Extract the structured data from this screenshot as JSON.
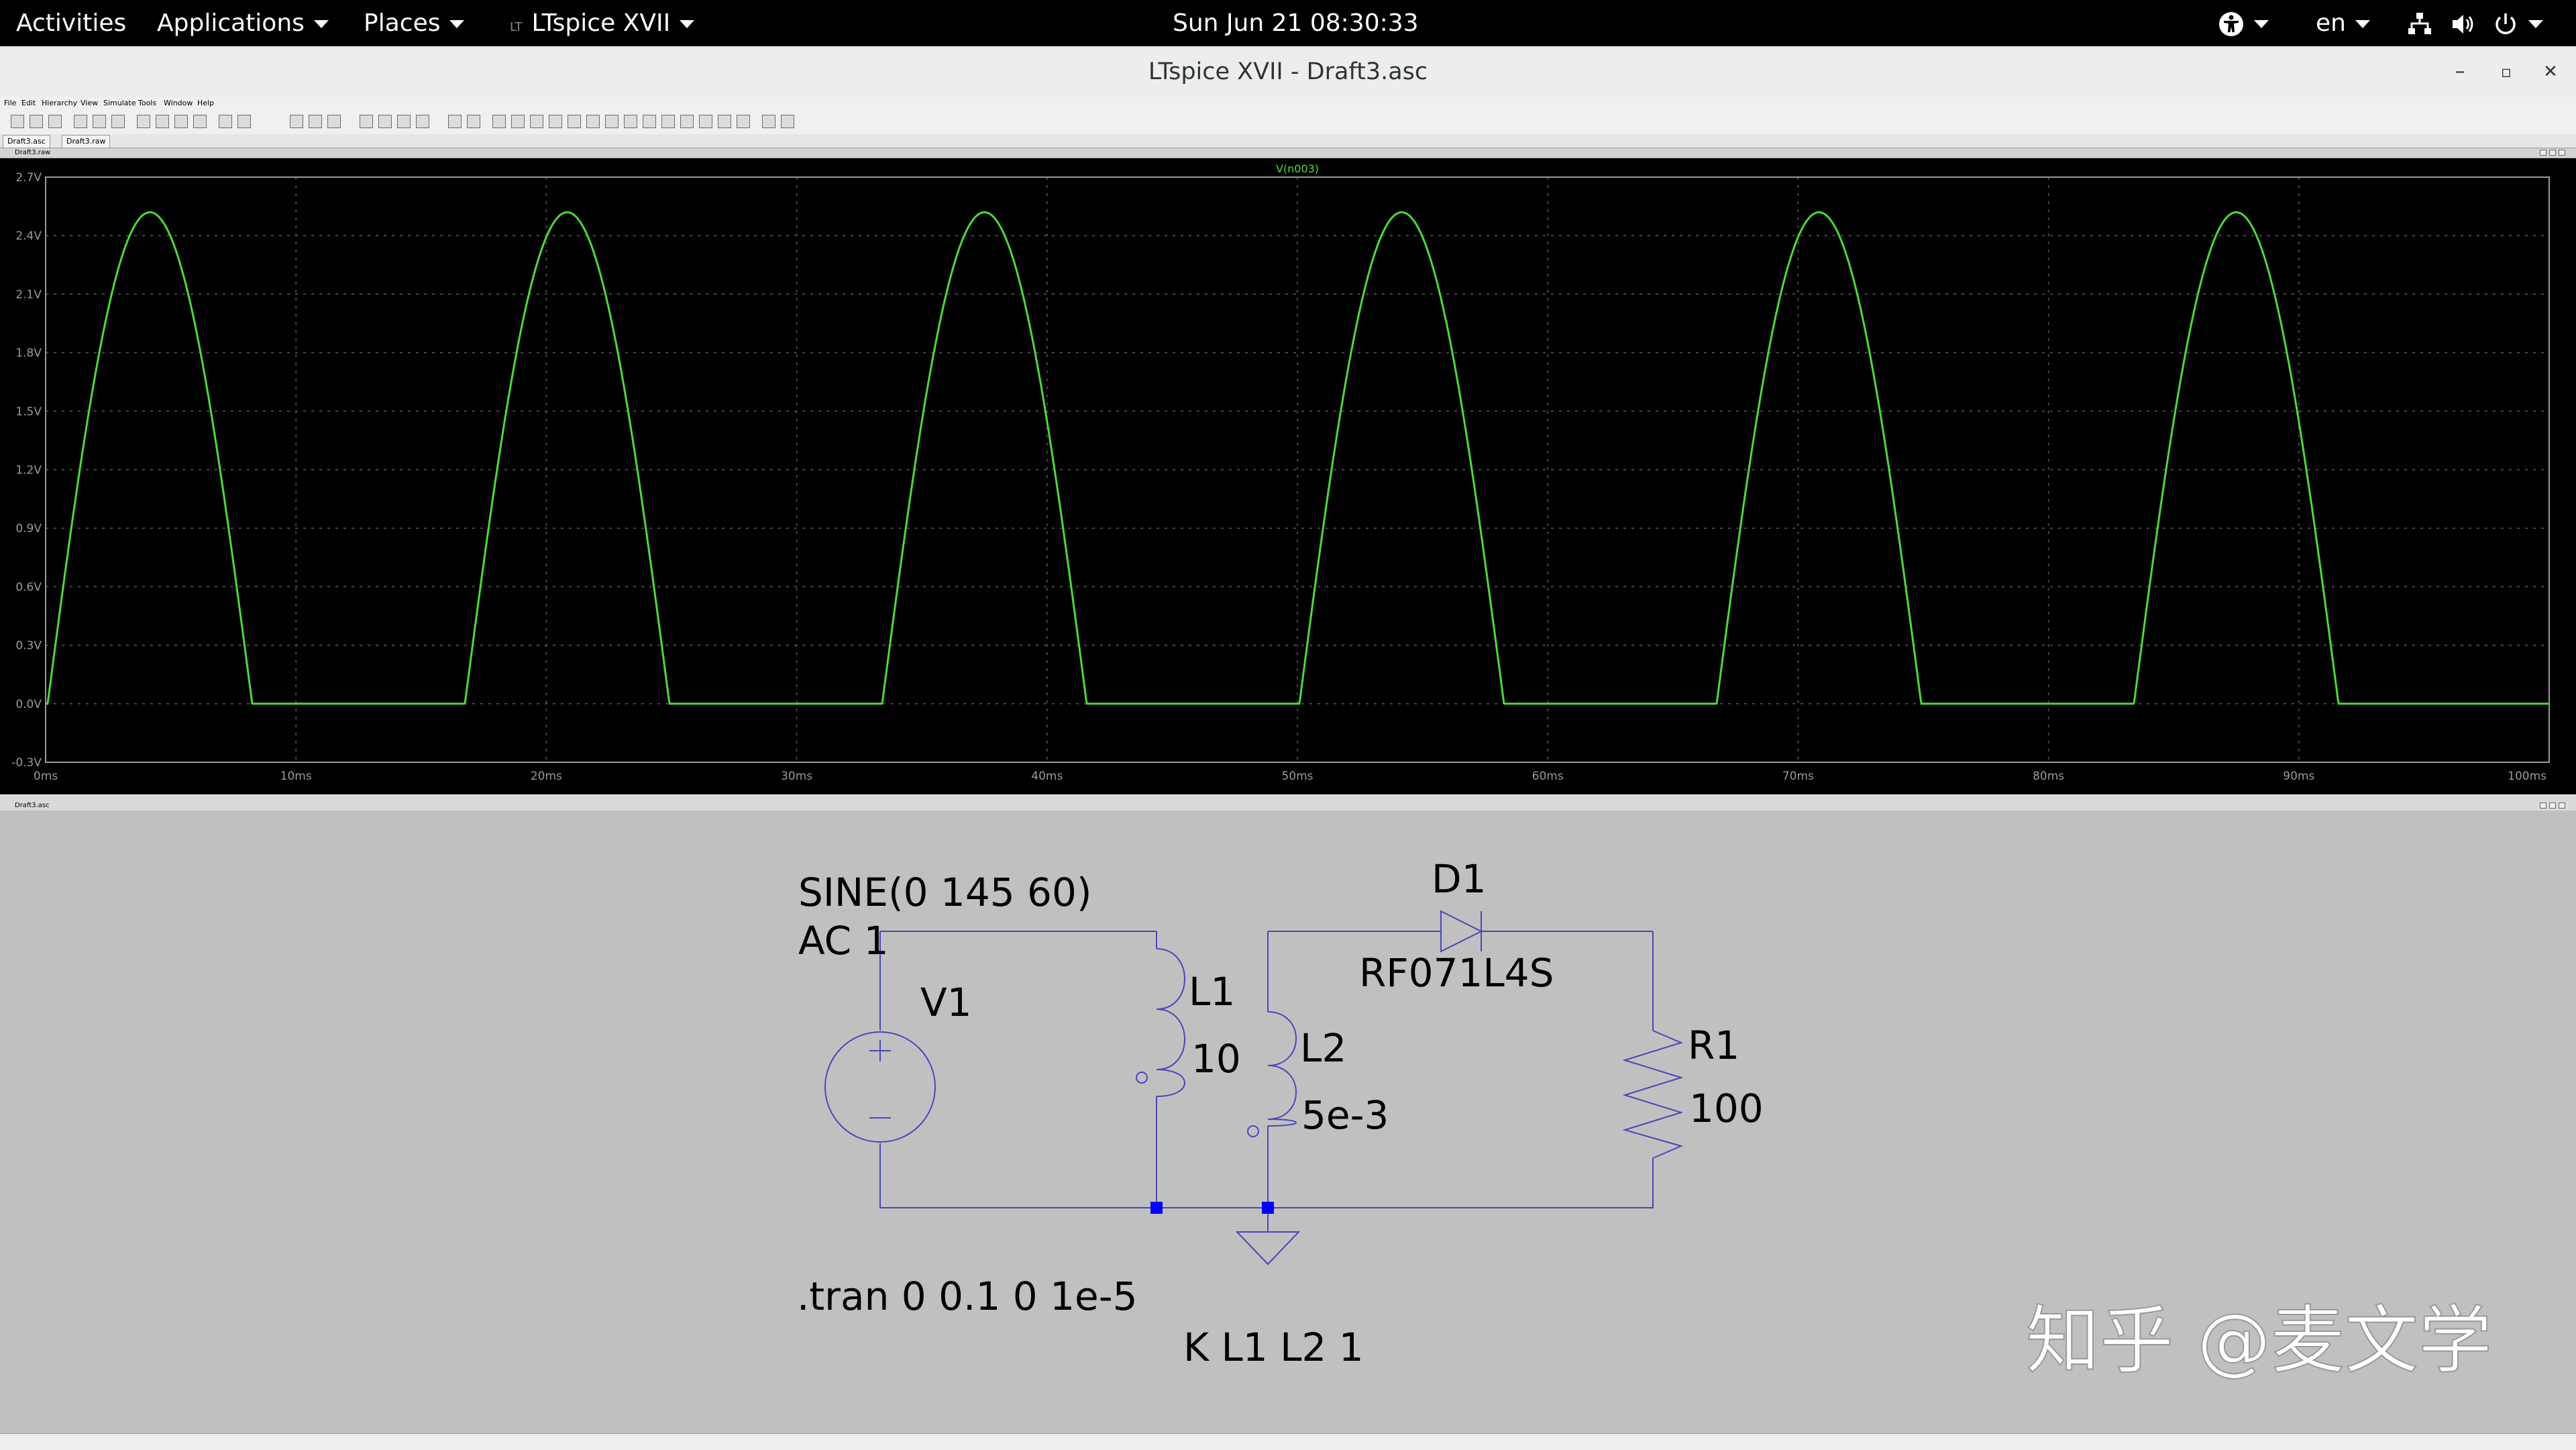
{
  "topbar": {
    "activities": "Activities",
    "applications": "Applications",
    "places": "Places",
    "app": "LTspice XVII",
    "clock": "Sun Jun 21  08:30:33",
    "lang": "en"
  },
  "window": {
    "title": "LTspice XVII - Draft3.asc",
    "minimize": "–",
    "maximize": "▫",
    "close": "✕"
  },
  "menu": [
    "File",
    "Edit",
    "Hierarchy",
    "View",
    "Simulate",
    "Tools",
    "Window",
    "Help"
  ],
  "tabs": [
    "Draft3.asc",
    "Draft3.raw"
  ],
  "waveform": {
    "pane_label": "Draft3.raw",
    "trace_color": "#4cd93a",
    "chart_data": {
      "type": "line",
      "series": [
        {
          "name": "V(n003)"
        }
      ],
      "xlim": [
        0,
        100
      ],
      "x_unit": "ms",
      "ylim": [
        -0.3,
        2.7
      ],
      "y_unit": "V",
      "x_ticks": [
        "0ms",
        "10ms",
        "20ms",
        "30ms",
        "40ms",
        "50ms",
        "60ms",
        "70ms",
        "80ms",
        "90ms",
        "100ms"
      ],
      "y_ticks": [
        "2.7V",
        "2.4V",
        "2.1V",
        "1.8V",
        "1.5V",
        "1.2V",
        "0.9V",
        "0.6V",
        "0.3V",
        "0.0V",
        "-0.3V"
      ],
      "signal": {
        "shape": "half-wave rectified sine",
        "frequency_hz": 60,
        "peak_v": 2.52,
        "conduction_threshold_v": 0.08
      },
      "grid": true
    }
  },
  "schematic": {
    "pane_label": "Draft3.asc",
    "wire_color": "#4848b8",
    "junction_color": "#0000ff",
    "texts": {
      "v1_value1": "SINE(0 145 60)",
      "v1_value2": "AC 1",
      "v1_name": "V1",
      "l1_name": "L1",
      "l1_value": "10",
      "l2_name": "L2",
      "l2_value": "5e-3",
      "d1_name": "D1",
      "d1_model": "RF071L4S",
      "r1_name": "R1",
      "r1_value": "100",
      "tran": ".tran 0 0.1 0 1e-5",
      "coupling": "K L1 L2 1"
    }
  },
  "watermark": "知乎 @麦文学"
}
